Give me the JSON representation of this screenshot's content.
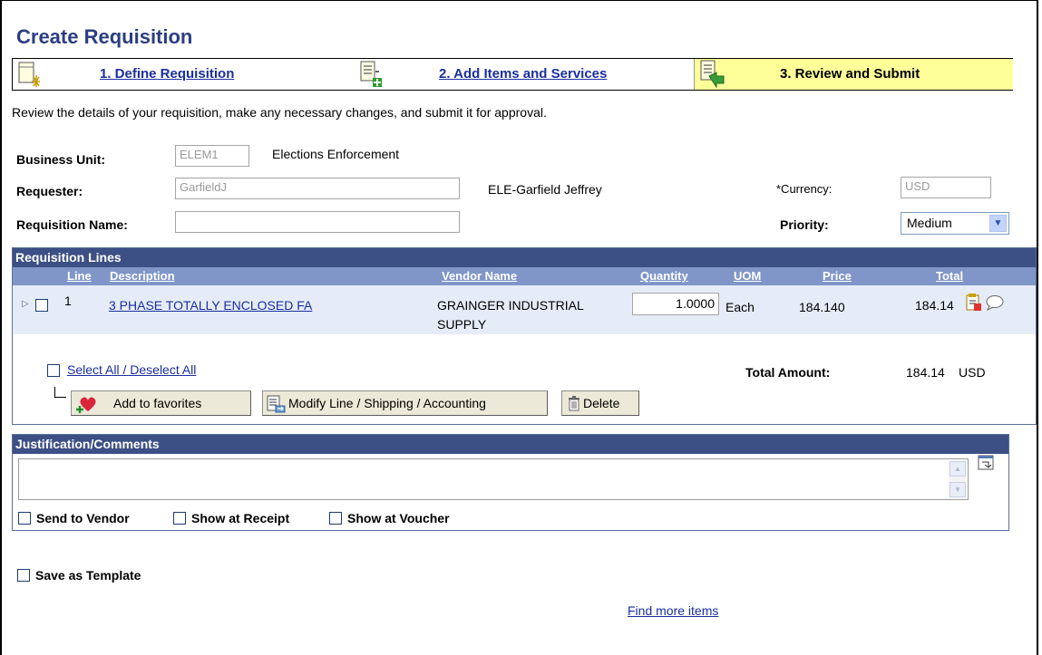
{
  "title": "Create Requisition",
  "steps": [
    {
      "label": "1. Define Requisition"
    },
    {
      "label": "2. Add Items and Services"
    },
    {
      "label": "3. Review and Submit"
    }
  ],
  "instructions": "Review the details of your requisition, make any necessary changes, and submit it for approval.",
  "header": {
    "business_unit_label": "Business Unit:",
    "business_unit_value": "ELEM1",
    "business_unit_desc": "Elections Enforcement",
    "requester_label": "Requester:",
    "requester_value": "GarfieldJ",
    "requester_desc": "ELE-Garfield Jeffrey",
    "currency_label": "*Currency:",
    "currency_value": "USD",
    "req_name_label": "Requisition Name:",
    "req_name_value": "",
    "priority_label": "Priority:",
    "priority_value": "Medium"
  },
  "lines": {
    "title": "Requisition Lines",
    "columns": [
      "Line",
      "Description",
      "Vendor Name",
      "Quantity",
      "UOM",
      "Price",
      "Total"
    ],
    "rows": [
      {
        "line": "1",
        "description": "3 PHASE TOTALLY ENCLOSED FA",
        "vendor_line1": "GRAINGER INDUSTRIAL",
        "vendor_line2": "SUPPLY",
        "quantity": "1.0000",
        "uom": "Each",
        "price": "184.140",
        "total": "184.14"
      }
    ],
    "select_all": "Select All / Deselect All",
    "total_amount_label": "Total Amount:",
    "total_amount_value": "184.14",
    "total_amount_currency": "USD",
    "buttons": {
      "favorites": "Add to favorites",
      "modify": "Modify Line / Shipping / Accounting",
      "delete": "Delete"
    }
  },
  "justification": {
    "title": "Justification/Comments",
    "text": "",
    "send_to_vendor": "Send to Vendor",
    "show_at_receipt": "Show at Receipt",
    "show_at_voucher": "Show at Voucher"
  },
  "save_as_template": "Save as Template",
  "find_more_items": "Find more items",
  "colors": {
    "title": "#2b3e82",
    "section_header": "#3d5085",
    "column_header": "#8096c9",
    "row_bg": "#e6ecf7",
    "current_step": "#ffff99",
    "link": "#1a2ea0"
  }
}
